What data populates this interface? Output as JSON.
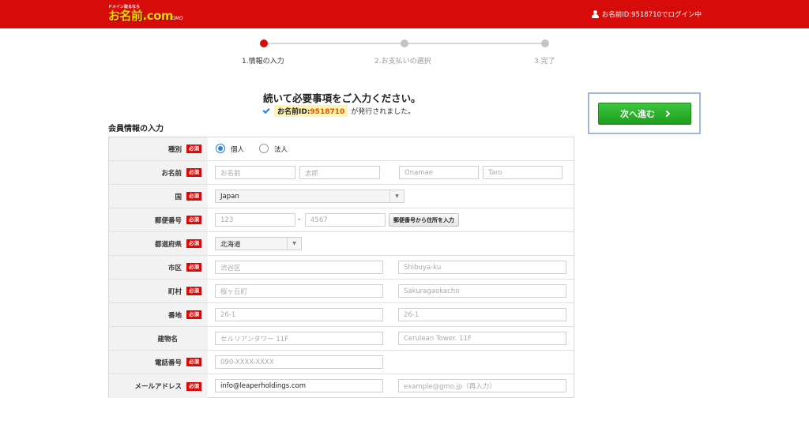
{
  "header": {
    "logo_tagline": "ドメイン取るなら",
    "logo_text": "お名前.com",
    "logo_sub": "GMO",
    "logo_badge": "",
    "login_status": "お名前ID:9518710でログイン中"
  },
  "steps": [
    {
      "label": "1.情報の入力",
      "active": true
    },
    {
      "label": "2.お支払いの選択",
      "active": false
    },
    {
      "label": "3.完了",
      "active": false
    }
  ],
  "intro": {
    "title": "続いて必要事項をご入力ください。",
    "id_prefix": "お名前ID:",
    "id_number": "9518710",
    "issued_suffix": "が発行されました。"
  },
  "next_button": "次へ進む",
  "section_title": "会員情報の入力",
  "required_label": "必須",
  "form": {
    "type": {
      "label": "種別",
      "options": [
        "個人",
        "法人"
      ],
      "selected": "個人"
    },
    "name": {
      "label": "お名前",
      "placeholders": [
        "お名前",
        "太郎",
        "Onamae",
        "Taro"
      ]
    },
    "country": {
      "label": "国",
      "value": "Japan"
    },
    "postal": {
      "label": "郵便番号",
      "placeholders": [
        "123",
        "4567"
      ],
      "separator": "-",
      "lookup_button": "郵便番号から住所を入力"
    },
    "prefecture": {
      "label": "都道府県",
      "value": "北海道"
    },
    "city": {
      "label": "市区",
      "placeholders": [
        "渋谷区",
        "Shibuya-ku"
      ]
    },
    "town": {
      "label": "町村",
      "placeholders": [
        "桜ヶ丘町",
        "Sakuragaokacho"
      ]
    },
    "block": {
      "label": "番地",
      "placeholders": [
        "26-1",
        "26-1"
      ]
    },
    "building": {
      "label": "建物名",
      "placeholders": [
        "セルリアンタワー 11F",
        "Cerulean Tower. 11F"
      ]
    },
    "phone": {
      "label": "電話番号",
      "placeholder": "090-XXXX-XXXX"
    },
    "email": {
      "label": "メールアドレス",
      "value": "info@leaperholdings.com",
      "confirm_placeholder": "example@gmo.jp（再入力）"
    }
  },
  "colors": {
    "brand_red": "#d80b0b",
    "next_green": "#2eb32e",
    "logo_yellow": "#ffd800"
  }
}
